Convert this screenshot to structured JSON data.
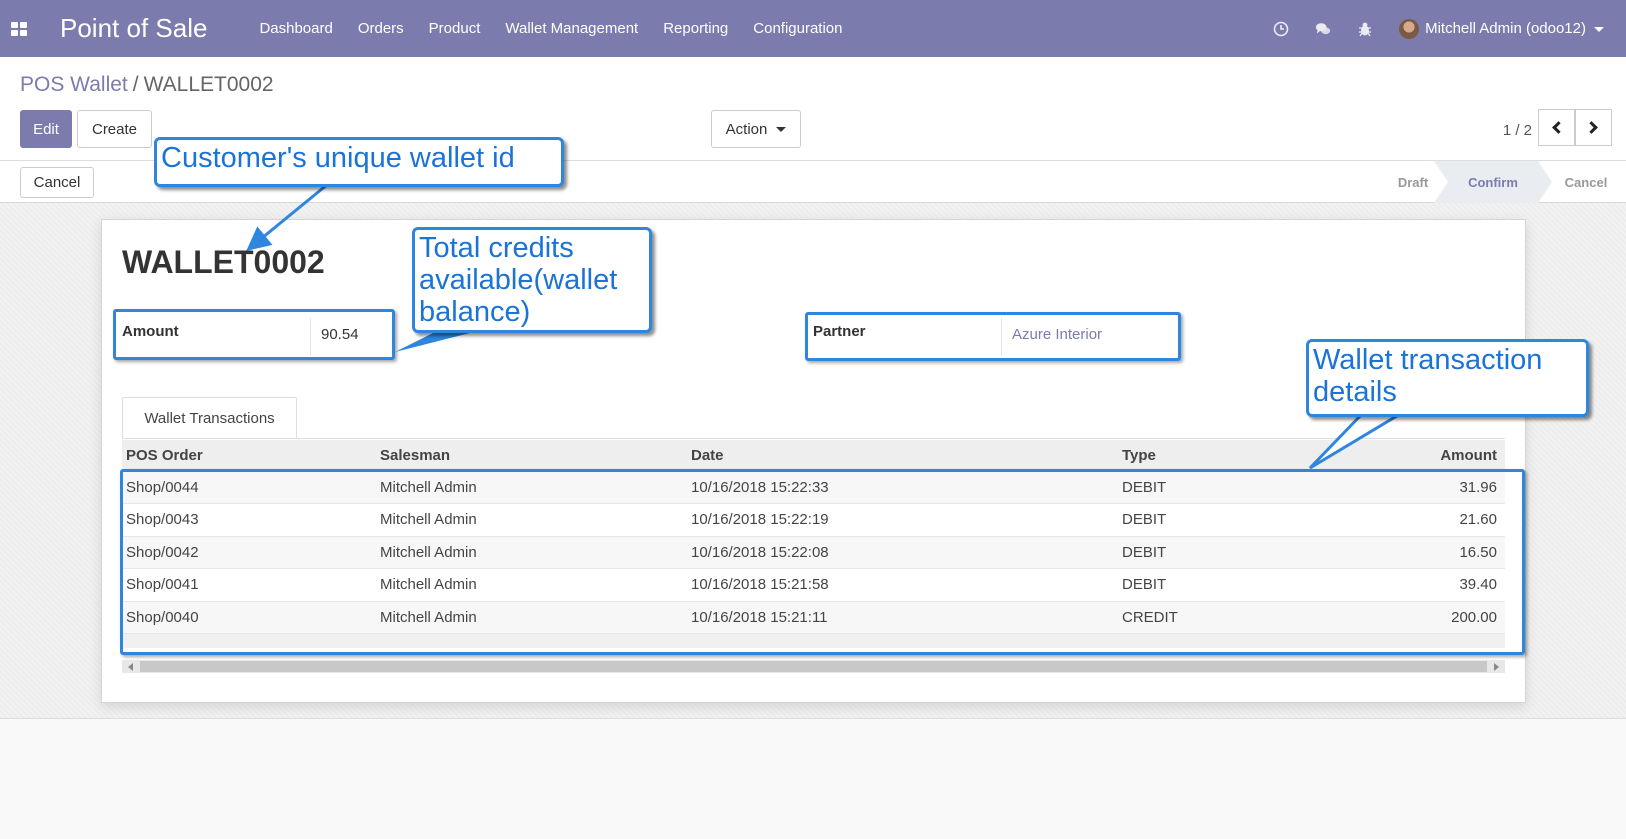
{
  "navbar": {
    "app_title": "Point of Sale",
    "menu": [
      "Dashboard",
      "Orders",
      "Product",
      "Wallet Management",
      "Reporting",
      "Configuration"
    ],
    "user": "Mitchell Admin (odoo12)",
    "icons": [
      "apps-icon",
      "clock-icon",
      "chat-icon",
      "bug-icon"
    ],
    "color": "#7c7bad"
  },
  "breadcrumb": {
    "parent": "POS Wallet",
    "separator": "/",
    "current": "WALLET0002"
  },
  "buttons": {
    "edit": "Edit",
    "create": "Create",
    "action": "Action",
    "cancel": "Cancel"
  },
  "pager": {
    "value": "1 / 2"
  },
  "status_steps": [
    "Draft",
    "Confirm",
    "Cancel"
  ],
  "active_status": "Confirm",
  "record": {
    "name": "WALLET0002",
    "amount_label": "Amount",
    "amount_value": "90.54",
    "partner_label": "Partner",
    "partner_value": "Azure Interior"
  },
  "tabs": [
    "Wallet Transactions"
  ],
  "transactions": {
    "headers": [
      "POS Order",
      "Salesman",
      "Date",
      "Type",
      "Amount"
    ],
    "rows": [
      [
        "Shop/0044",
        "Mitchell Admin",
        "10/16/2018 15:22:33",
        "DEBIT",
        "31.96"
      ],
      [
        "Shop/0043",
        "Mitchell Admin",
        "10/16/2018 15:22:19",
        "DEBIT",
        "21.60"
      ],
      [
        "Shop/0042",
        "Mitchell Admin",
        "10/16/2018 15:22:08",
        "DEBIT",
        "16.50"
      ],
      [
        "Shop/0041",
        "Mitchell Admin",
        "10/16/2018 15:21:58",
        "DEBIT",
        "39.40"
      ],
      [
        "Shop/0040",
        "Mitchell Admin",
        "10/16/2018 15:21:11",
        "CREDIT",
        "200.00"
      ]
    ]
  },
  "annotations": {
    "wallet_id": "Customer's unique wallet id",
    "credits_line1": "Total credits",
    "credits_line2": "available(wallet",
    "credits_line3": "balance)",
    "transactions_line1": "Wallet transaction",
    "transactions_line2": "details",
    "color": "#2e86de"
  }
}
